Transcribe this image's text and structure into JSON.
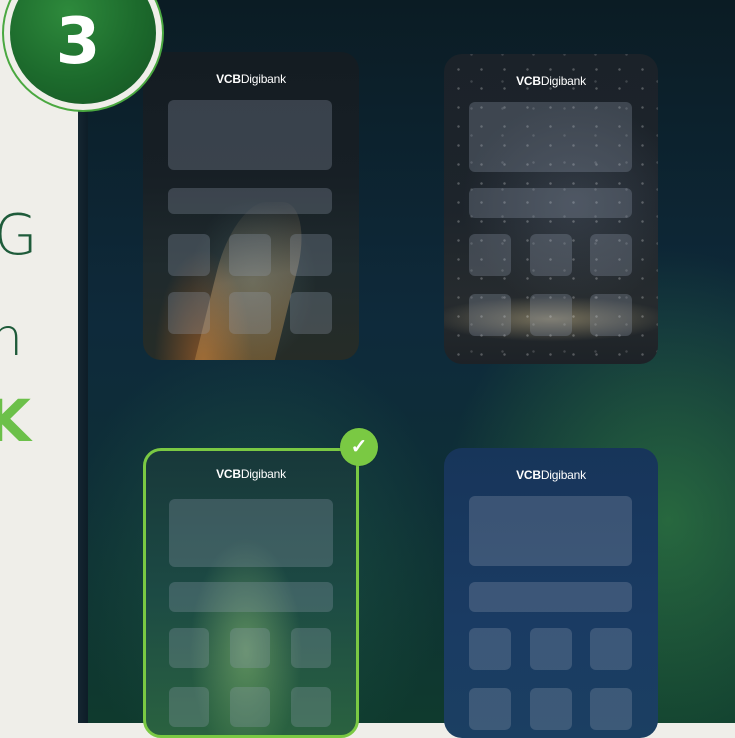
{
  "step": {
    "number": "3"
  },
  "left_panel": {
    "chars": [
      "G",
      "n",
      "K"
    ]
  },
  "themes": [
    {
      "brand_bold": "VCB",
      "brand_regular": "Digibank",
      "style": "night-road",
      "selected": false
    },
    {
      "brand_bold": "VCB",
      "brand_regular": "Digibank",
      "style": "starry-sky",
      "selected": false
    },
    {
      "brand_bold": "VCB",
      "brand_regular": "Digibank",
      "style": "green",
      "selected": true
    },
    {
      "brand_bold": "VCB",
      "brand_regular": "Digibank",
      "style": "blue",
      "selected": false
    }
  ],
  "colors": {
    "accent_green": "#7ac943",
    "badge_green": "#1c6a2c",
    "background_beige": "#efeee9",
    "dark_bg": "#0e2a3b"
  },
  "icons": {
    "selected_check": "check-icon"
  }
}
